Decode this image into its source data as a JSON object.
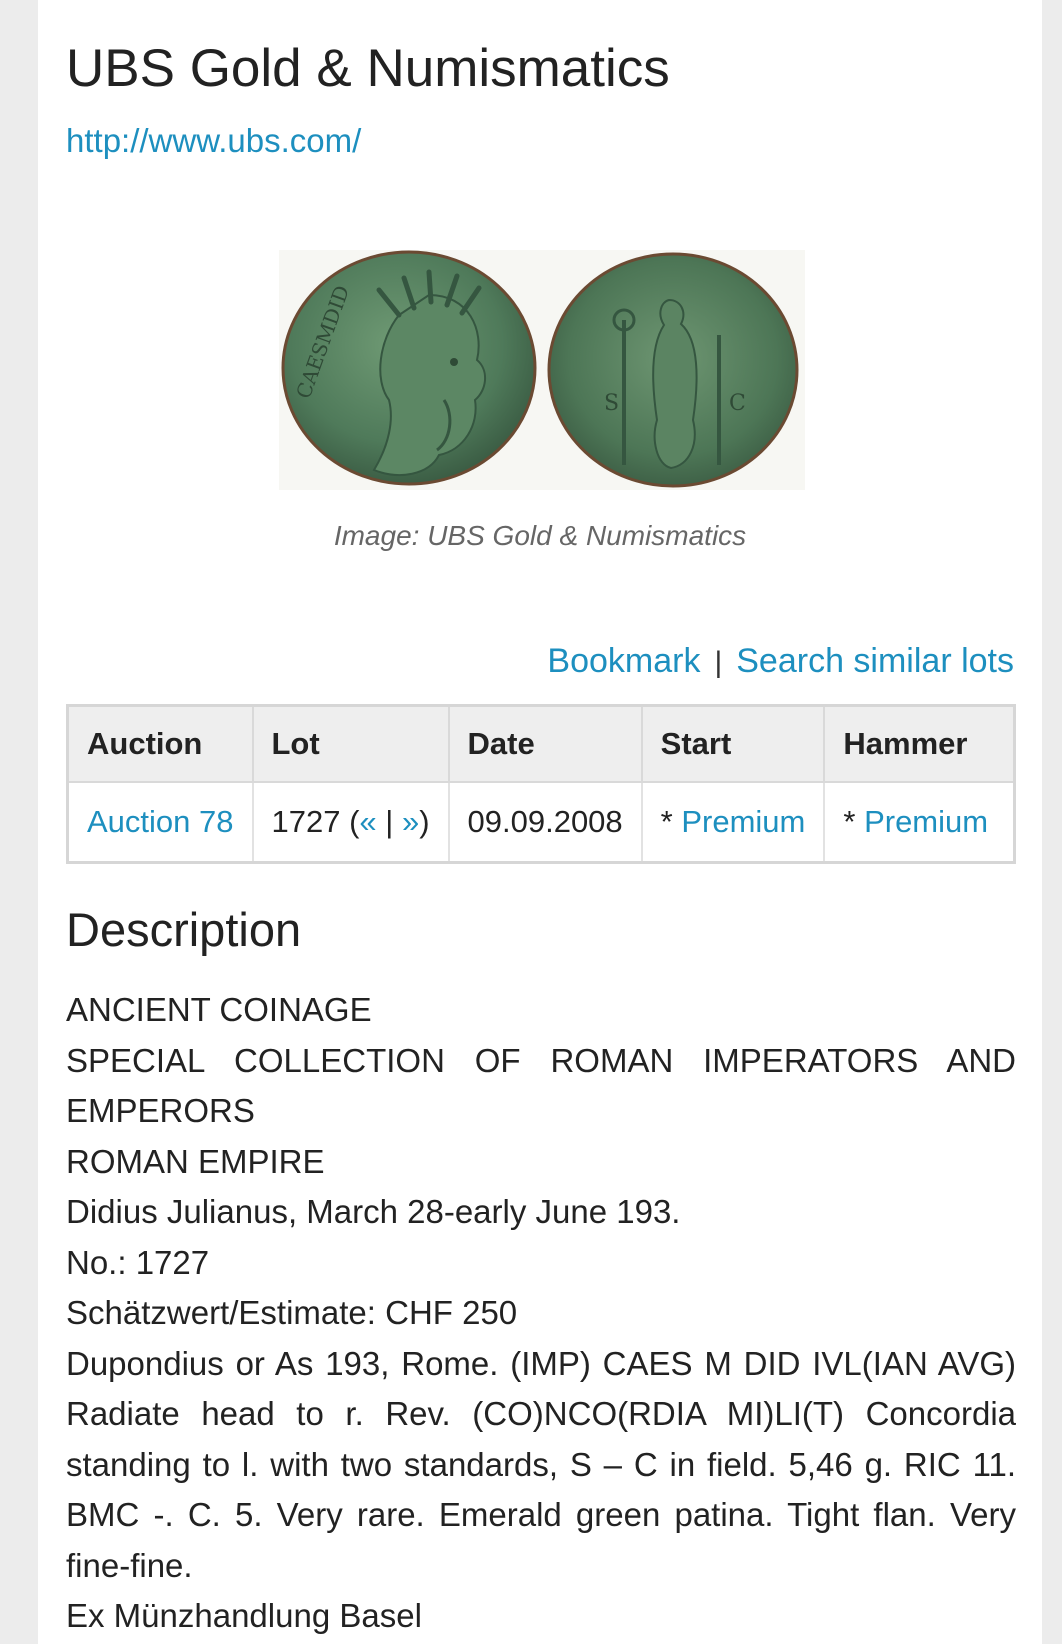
{
  "header": {
    "title": "UBS Gold & Numismatics",
    "url": "http://www.ubs.com/"
  },
  "image": {
    "caption": "Image: UBS Gold & Numismatics"
  },
  "actions": {
    "bookmark": "Bookmark",
    "separator": "|",
    "search_similar": "Search similar lots"
  },
  "table": {
    "headers": [
      "Auction",
      "Lot",
      "Date",
      "Start",
      "Hammer"
    ],
    "row": {
      "auction": "Auction 78",
      "lot_number": "1727",
      "lot_open": " (",
      "prev": "«",
      "lot_sep": " | ",
      "next": "»",
      "lot_close": ")",
      "date": "09.09.2008",
      "start_prefix": "* ",
      "start": "Premium",
      "hammer_prefix": "* ",
      "hammer": "Premium"
    }
  },
  "description": {
    "heading": "Description",
    "lines": [
      "ANCIENT COINAGE",
      "SPECIAL COLLECTION OF ROMAN IMPERATORS AND EMPERORS",
      "ROMAN EMPIRE",
      "Didius Julianus, March 28-early June 193.",
      "No.: 1727",
      "Schätzwert/Estimate: CHF 250",
      "Dupondius or As 193, Rome. (IMP) CAES M DID IVL(IAN AVG) Radiate head to r. Rev. (CO)NCO(RDIA MI)LI(T) Concordia standing to l. with two standards, S – C in field. 5,46 g. RIC 11. BMC -. C. 5. Very rare. Emerald green patina. Tight flan. Very fine-fine.",
      "Ex Münzhandlung Basel"
    ]
  },
  "colors": {
    "link": "#1d8fbf",
    "coin_patina": "#4f7a5a"
  }
}
